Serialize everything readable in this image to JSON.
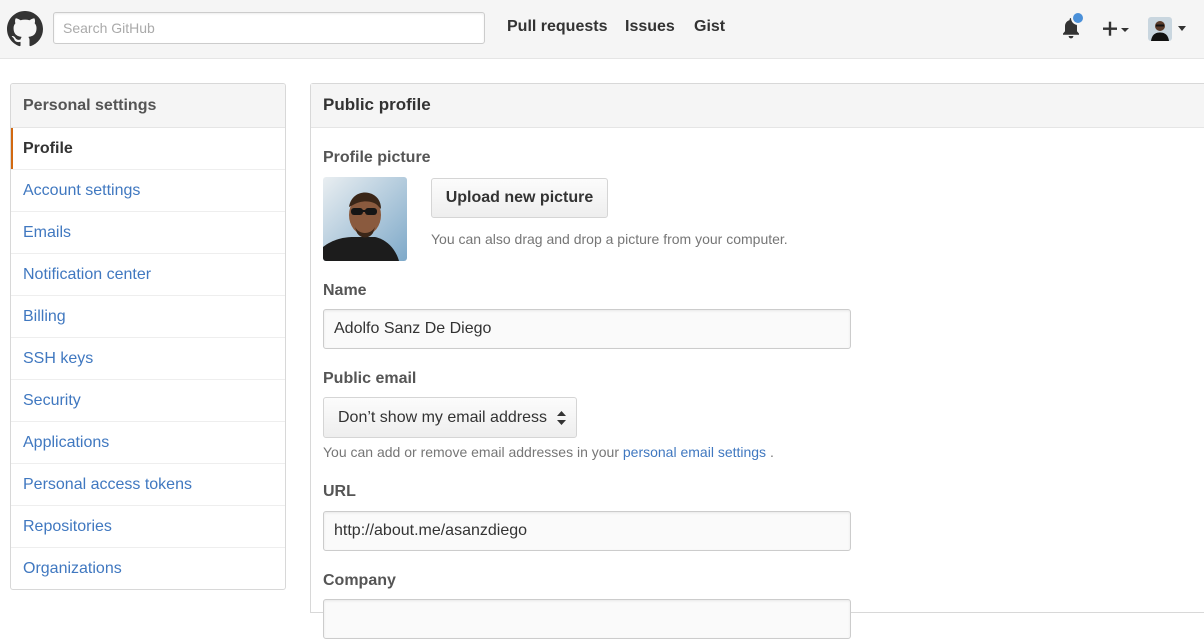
{
  "header": {
    "search_placeholder": "Search GitHub",
    "nav": [
      "Pull requests",
      "Issues",
      "Gist"
    ],
    "icons": [
      "github-mark-icon",
      "bell-icon",
      "plus-icon",
      "avatar",
      "chevron-down-icon"
    ]
  },
  "sidebar": {
    "heading": "Personal settings",
    "items": [
      {
        "label": "Profile",
        "selected": true
      },
      {
        "label": "Account settings"
      },
      {
        "label": "Emails"
      },
      {
        "label": "Notification center"
      },
      {
        "label": "Billing"
      },
      {
        "label": "SSH keys"
      },
      {
        "label": "Security"
      },
      {
        "label": "Applications"
      },
      {
        "label": "Personal access tokens"
      },
      {
        "label": "Repositories"
      },
      {
        "label": "Organizations"
      }
    ]
  },
  "main": {
    "heading": "Public profile",
    "profile_picture": {
      "label": "Profile picture",
      "upload_button": "Upload new picture",
      "hint": "You can also drag and drop a picture from your computer."
    },
    "name": {
      "label": "Name",
      "value": "Adolfo Sanz De Diego"
    },
    "public_email": {
      "label": "Public email",
      "selected": "Don’t show my email address",
      "hint_prefix": "You can add or remove email addresses in your",
      "hint_link": "personal email settings",
      "hint_suffix": "."
    },
    "url": {
      "label": "URL",
      "value": "http://about.me/asanzdiego"
    },
    "company": {
      "label": "Company"
    }
  },
  "colors": {
    "link": "#4078c0",
    "selected_marker": "#d26911",
    "notification_dot": "#4a90d9",
    "header_bg": "#f5f5f5"
  }
}
